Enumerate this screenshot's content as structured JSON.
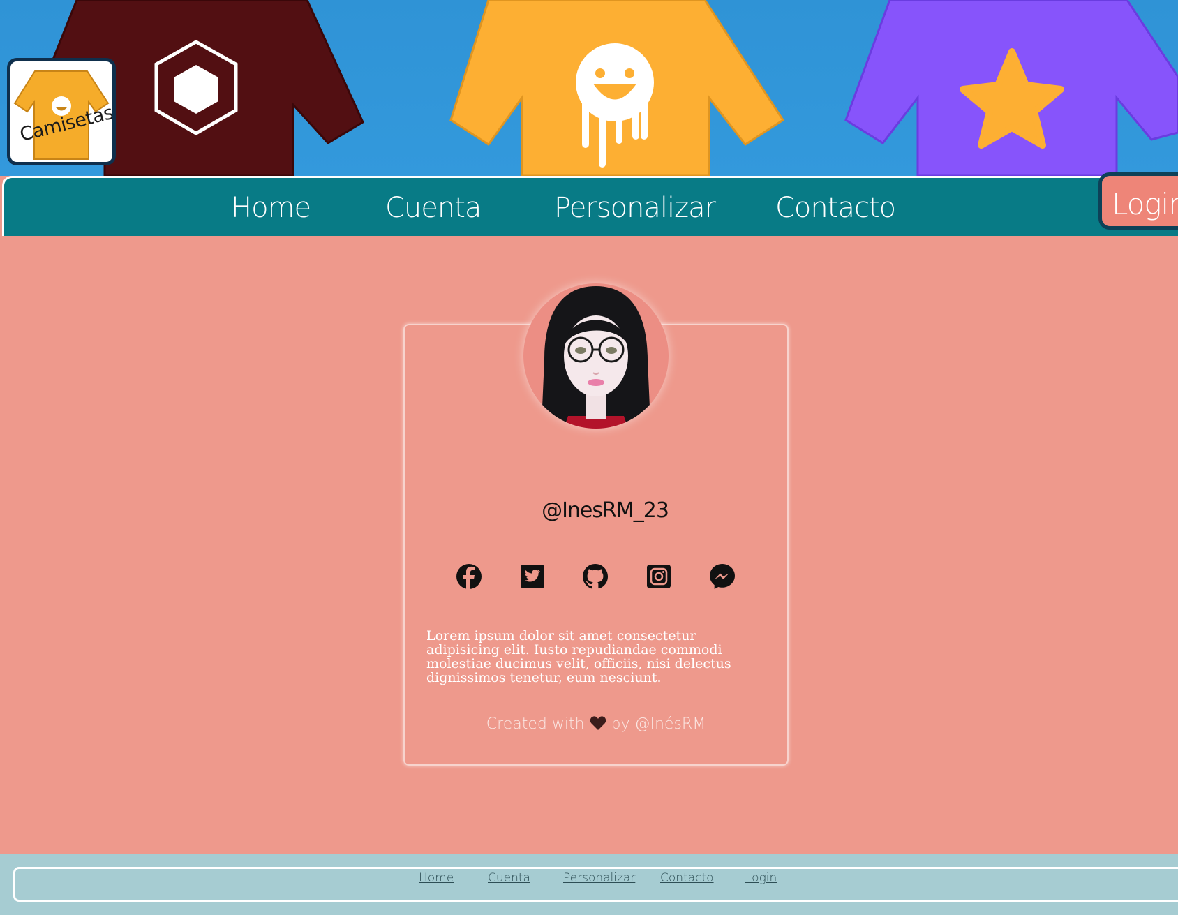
{
  "brand": {
    "logo_text": "Camisetas"
  },
  "nav": {
    "items": [
      "Home",
      "Cuenta",
      "Personalizar",
      "Contacto"
    ],
    "login_label": "Login"
  },
  "profile": {
    "username": "@InesRM_23",
    "social": [
      "facebook-icon",
      "twitter-icon",
      "github-icon",
      "instagram-icon",
      "messenger-icon"
    ],
    "bio": "Lorem ipsum dolor sit amet consectetur adipisicing elit. Iusto repudiandae commodi molestiae ducimus velit, officiis, nisi delectus dignissimos tenetur, eum nesciunt.",
    "credit_prefix": "Created with",
    "credit_suffix": "by @InésRM"
  },
  "footer": {
    "links": [
      "Home",
      "Cuenta",
      "Personalizar",
      "Contacto",
      "Login"
    ]
  },
  "colors": {
    "background": "#ee998c",
    "nav": "#087b86",
    "footer": "#a6ccd2",
    "login": "#ee8578"
  }
}
